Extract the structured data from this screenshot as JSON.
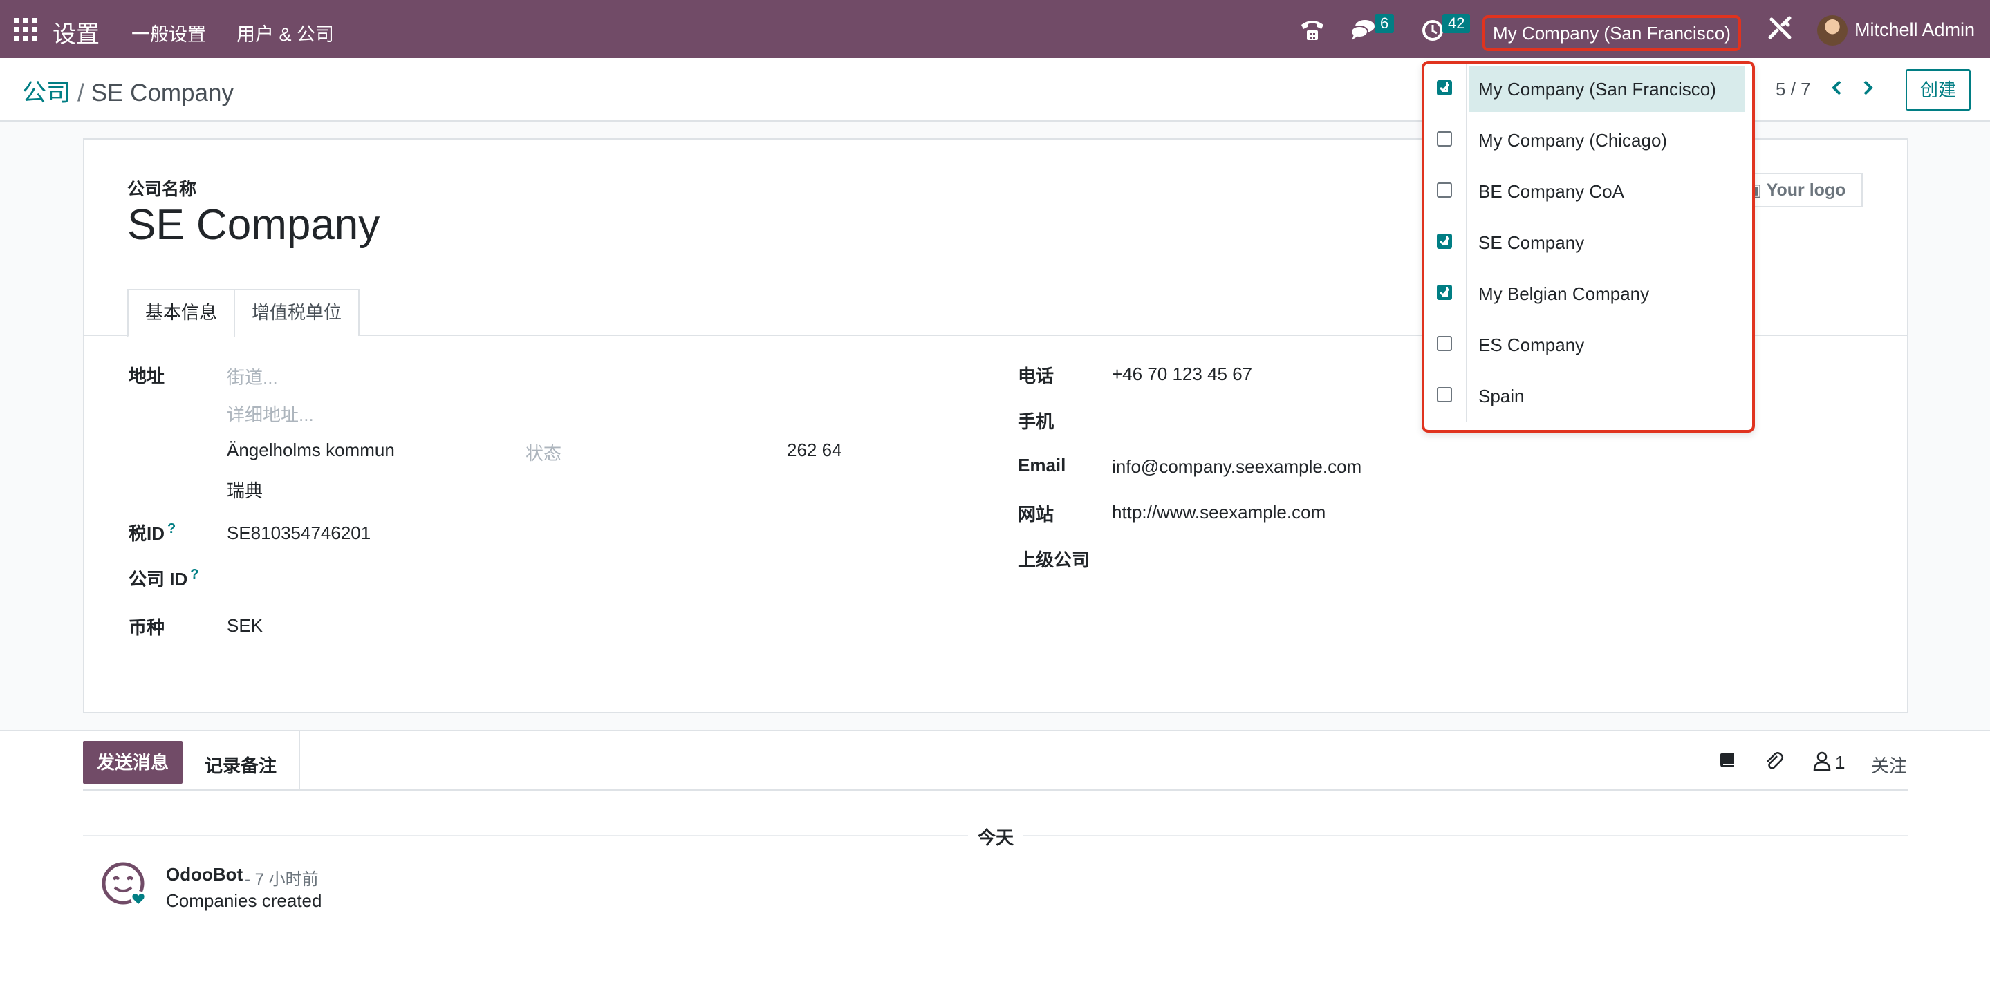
{
  "navbar": {
    "app_title": "设置",
    "menu": [
      "一般设置",
      "用户 & 公司"
    ],
    "messages_badge": "6",
    "activities_badge": "42",
    "current_company": "My Company (San Francisco)",
    "user_name": "Mitchell Admin",
    "color": "#714b67"
  },
  "control_panel": {
    "breadcrumb_parent": "公司",
    "breadcrumb_sep": "/",
    "breadcrumb_current": "SE Company",
    "pager": "5 / 7",
    "create_label": "创建"
  },
  "form": {
    "name_label": "公司名称",
    "name_value": "SE Company",
    "logo_label": "Your logo",
    "tabs": [
      "基本信息",
      "增值税单位"
    ],
    "address_label": "地址",
    "street_placeholder": "街道...",
    "street2_placeholder": "详细地址...",
    "city": "Ängelholms kommun",
    "state_placeholder": "状态",
    "zip": "262 64",
    "country": "瑞典",
    "tax_id_label": "税ID",
    "tax_id_value": "SE810354746201",
    "company_id_label": "公司 ID",
    "help_mark": "?",
    "currency_label": "币种",
    "currency_value": "SEK",
    "phone_label": "电话",
    "phone_value": "+46 70 123 45 67",
    "mobile_label": "手机",
    "email_label": "Email",
    "email_value": "info@company.seexample.com",
    "website_label": "网站",
    "website_value": "http://www.seexample.com",
    "parent_label": "上级公司"
  },
  "chatter": {
    "send_label": "发送消息",
    "note_label": "记录备注",
    "followers_count": "1",
    "follow_label": "关注",
    "day_label": "今天",
    "message": {
      "author": "OdooBot",
      "time": "- 7 小时前",
      "body": "Companies created"
    }
  },
  "company_switcher": {
    "items": [
      {
        "name": "My Company (San Francisco)",
        "checked": true,
        "active": true
      },
      {
        "name": "My Company (Chicago)",
        "checked": false,
        "active": false
      },
      {
        "name": "BE Company CoA",
        "checked": false,
        "active": false
      },
      {
        "name": "SE Company",
        "checked": true,
        "active": false
      },
      {
        "name": "My Belgian Company",
        "checked": true,
        "active": false
      },
      {
        "name": "ES Company",
        "checked": false,
        "active": false
      },
      {
        "name": "Spain",
        "checked": false,
        "active": false
      }
    ],
    "highlight_color": "#e0331f",
    "accent_color": "#017e84"
  }
}
